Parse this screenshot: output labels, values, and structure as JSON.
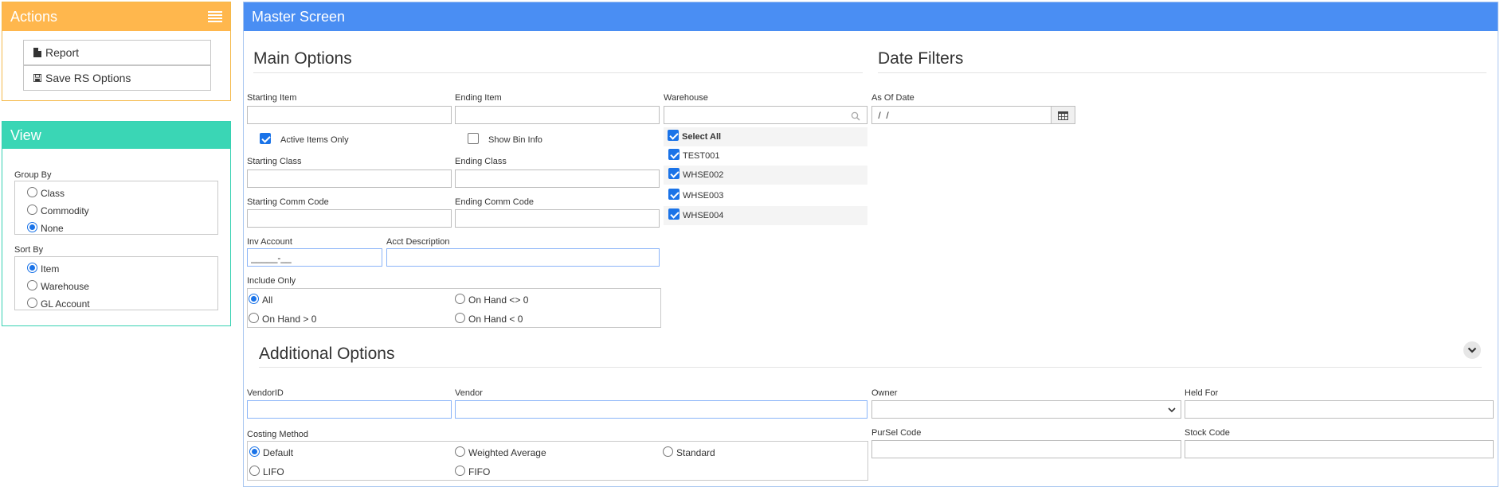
{
  "actions": {
    "title": "Actions",
    "items": [
      {
        "label": "Report",
        "icon": "document-icon"
      },
      {
        "label": "Save RS Options",
        "icon": "save-icon"
      }
    ]
  },
  "view": {
    "title": "View",
    "group_by": {
      "label": "Group By",
      "options": [
        "Class",
        "Commodity",
        "None"
      ],
      "selected": "None"
    },
    "sort_by": {
      "label": "Sort By",
      "options": [
        "Item",
        "Warehouse",
        "GL Account"
      ],
      "selected": "Item"
    }
  },
  "master": {
    "title": "Master Screen",
    "main_options": {
      "title": "Main Options",
      "starting_item": {
        "label": "Starting Item",
        "value": ""
      },
      "ending_item": {
        "label": "Ending Item",
        "value": ""
      },
      "active_items_only": {
        "label": "Active Items Only",
        "checked": true
      },
      "show_bin_info": {
        "label": "Show Bin Info",
        "checked": false
      },
      "starting_class": {
        "label": "Starting Class",
        "value": ""
      },
      "ending_class": {
        "label": "Ending Class",
        "value": ""
      },
      "starting_comm_code": {
        "label": "Starting Comm Code",
        "value": ""
      },
      "ending_comm_code": {
        "label": "Ending Comm Code",
        "value": ""
      },
      "inv_account": {
        "label": "Inv Account",
        "value": "_____-__"
      },
      "acct_description": {
        "label": "Acct Description",
        "value": ""
      },
      "include_only": {
        "label": "Include Only",
        "options": [
          "All",
          "On Hand <> 0",
          "On Hand > 0",
          "On Hand < 0"
        ],
        "selected": "All"
      },
      "warehouse": {
        "label": "Warehouse",
        "search_value": "",
        "select_all_label": "Select All",
        "items": [
          {
            "label": "TEST001",
            "checked": true
          },
          {
            "label": "WHSE002",
            "checked": true
          },
          {
            "label": "WHSE003",
            "checked": true
          },
          {
            "label": "WHSE004",
            "checked": true
          }
        ]
      }
    },
    "date_filters": {
      "title": "Date Filters",
      "as_of_date": {
        "label": "As Of Date",
        "value": " /  /"
      }
    },
    "additional_options": {
      "title": "Additional Options",
      "vendor_id": {
        "label": "VendorID",
        "value": ""
      },
      "vendor": {
        "label": "Vendor",
        "value": ""
      },
      "owner": {
        "label": "Owner",
        "value": ""
      },
      "held_for": {
        "label": "Held For",
        "value": ""
      },
      "costing_method": {
        "label": "Costing Method",
        "options": [
          "Default",
          "Weighted Average",
          "Standard",
          "LIFO",
          "FIFO"
        ],
        "selected": "Default"
      },
      "pursel_code": {
        "label": "PurSel Code",
        "value": ""
      },
      "stock_code": {
        "label": "Stock Code",
        "value": ""
      }
    }
  },
  "colors": {
    "actions_header": "#ffb74d",
    "view_header": "#3ad6b5",
    "master_header": "#4a8ef3",
    "accent": "#1a73e8"
  }
}
